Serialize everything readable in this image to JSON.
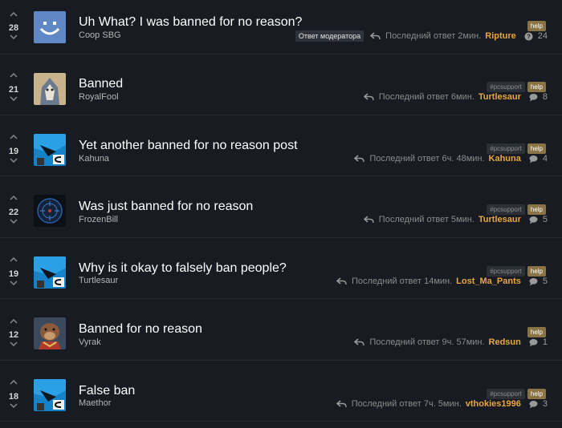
{
  "threads": [
    {
      "votes": "28",
      "title": "Uh What? I was banned for no reason?",
      "author": "Coop SBG",
      "tags": [
        "help"
      ],
      "badge": "Ответ модератора",
      "last_label": "Последний ответ 2мин.",
      "last_user": "Ripture",
      "count_icon": "question-icon",
      "count": "24"
    },
    {
      "votes": "21",
      "title": "Banned",
      "author": "RoyalFool",
      "tags": [
        "#pcsupport",
        "help"
      ],
      "last_label": "Последний ответ 6мин.",
      "last_user": "Turtlesaur",
      "count_icon": "comment-icon",
      "count": "8"
    },
    {
      "votes": "19",
      "title": "Yet another banned for no reason post",
      "author": "Kahuna",
      "tags": [
        "#pcsupport",
        "help"
      ],
      "last_label": "Последний ответ 6ч. 48мин.",
      "last_user": "Kahuna",
      "count_icon": "comment-icon",
      "count": "4"
    },
    {
      "votes": "22",
      "title": "Was just banned for no reason",
      "author": "FrozenBill",
      "tags": [
        "#pcsupport",
        "help"
      ],
      "last_label": "Последний ответ 5мин.",
      "last_user": "Turtlesaur",
      "count_icon": "comment-icon",
      "count": "5"
    },
    {
      "votes": "19",
      "title": "Why is it okay to falsely ban people?",
      "author": "Turtlesaur",
      "tags": [
        "#pcsupport",
        "help"
      ],
      "last_label": "Последний ответ 14мин.",
      "last_user": "Lost_Ma_Pants",
      "count_icon": "comment-icon",
      "count": "5"
    },
    {
      "votes": "12",
      "title": "Banned for no reason",
      "author": "Vyrak",
      "tags": [
        "help"
      ],
      "last_label": "Последний ответ 9ч. 57мин.",
      "last_user": "Redsun",
      "count_icon": "comment-icon",
      "count": "1"
    },
    {
      "votes": "18",
      "title": "False ban",
      "author": "Maethor",
      "tags": [
        "#pcsupport",
        "help"
      ],
      "last_label": "Последний ответ 7ч. 5мин.",
      "last_user": "vthokies1996",
      "count_icon": "comment-icon",
      "count": "3"
    }
  ],
  "colors": {
    "background": "#181b21",
    "accent_user": "#e9a63f",
    "tag_help": "#8a7344"
  }
}
